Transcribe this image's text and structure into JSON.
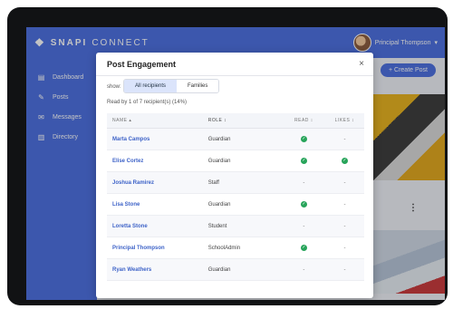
{
  "app": {
    "logo_brand": "SNAPI",
    "logo_rest": "CONNECT"
  },
  "user": {
    "name": "Principal Thompson",
    "caret": "▾"
  },
  "sidebar": {
    "items": [
      {
        "label": "Dashboard",
        "icon": "dashboard-icon",
        "glyph": "▤"
      },
      {
        "label": "Posts",
        "icon": "posts-icon",
        "glyph": "✎"
      },
      {
        "label": "Messages",
        "icon": "messages-icon",
        "glyph": "✉"
      },
      {
        "label": "Directory",
        "icon": "directory-icon",
        "glyph": "▥"
      }
    ]
  },
  "main": {
    "create_button": "+ Create Post",
    "more": "⋮"
  },
  "modal": {
    "title": "Post Engagement",
    "close": "×",
    "show_label": "show:",
    "filters": [
      {
        "label": "All recipients",
        "active": true
      },
      {
        "label": "Families",
        "active": false
      }
    ],
    "read_by": "Read by 1 of 7 recipient(s) (14%)",
    "columns": {
      "name": "NAME ▴",
      "role": "ROLE ↕",
      "read": "READ ↕",
      "likes": "LIKES ↕"
    },
    "rows": [
      {
        "name": "Marta Campos",
        "role": "Guardian",
        "read": true,
        "likes": false
      },
      {
        "name": "Elise Cortez",
        "role": "Guardian",
        "read": true,
        "likes": true
      },
      {
        "name": "Joshua Ramirez",
        "role": "Staff",
        "read": false,
        "likes": false
      },
      {
        "name": "Lisa Stone",
        "role": "Guardian",
        "read": true,
        "likes": false
      },
      {
        "name": "Loretta Stone",
        "role": "Student",
        "read": false,
        "likes": false
      },
      {
        "name": "Principal Thompson",
        "role": "SchoolAdmin",
        "read": true,
        "likes": false
      },
      {
        "name": "Ryan Weathers",
        "role": "Guardian",
        "read": false,
        "likes": false
      }
    ],
    "check_glyph": "✓",
    "dash_glyph": "-"
  },
  "colors": {
    "brand": "#4a6ee0",
    "check": "#27a45a"
  }
}
